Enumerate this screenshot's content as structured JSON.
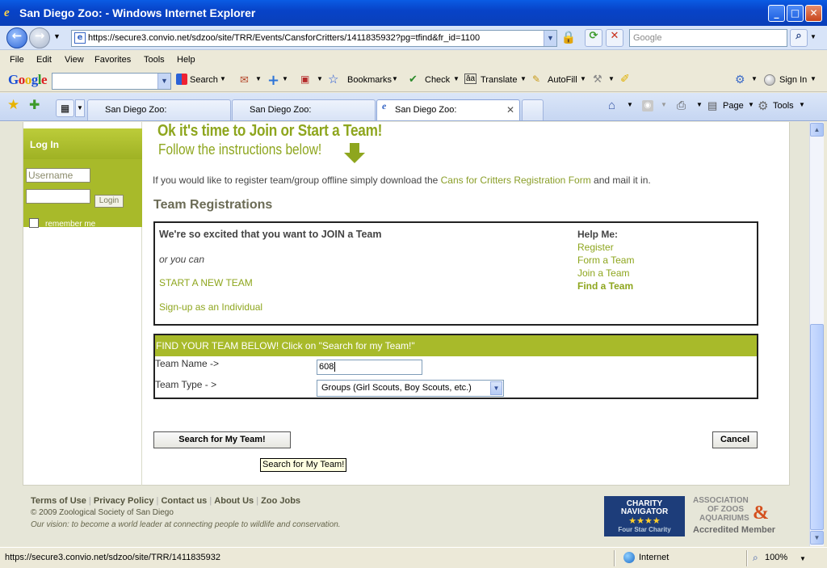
{
  "window": {
    "title": "San Diego Zoo: - Windows Internet Explorer"
  },
  "address_bar": {
    "url": "https://secure3.convio.net/sdzoo/site/TRR/Events/CansforCritters/1411835932?pg=tfind&fr_id=1100",
    "search_placeholder": "Google"
  },
  "menu": [
    "File",
    "Edit",
    "View",
    "Favorites",
    "Tools",
    "Help"
  ],
  "google_toolbar": {
    "logo": "Google",
    "search": "Search",
    "bookmarks": "Bookmarks",
    "check": "Check",
    "translate": "Translate",
    "autofill": "AutoFill",
    "signin": "Sign In"
  },
  "tabs": [
    {
      "label": "San Diego Zoo:",
      "active": false
    },
    {
      "label": "San Diego Zoo:",
      "active": false
    },
    {
      "label": "San Diego Zoo:",
      "active": true
    }
  ],
  "command_bar": {
    "page": "Page",
    "tools": "Tools"
  },
  "sidebar": {
    "login_title": "Log In",
    "username_placeholder": "Username",
    "login_button": "Login",
    "remember_label": "remember me"
  },
  "main": {
    "heading1": "Ok it's time to Join or Start a Team!",
    "heading2": "Follow the instructions below!",
    "intro_before": "If you would like to register team/group offline simply download the ",
    "intro_link": "Cans for Critters Registration Form",
    "intro_after": " and mail it in.",
    "section_title": "Team Registrations",
    "join_heading": "We're so excited that you want to JOIN a Team",
    "or_you_can": "or you can",
    "start_team": "START A NEW TEAM",
    "signup_individual": "Sign-up as an Individual",
    "help_title": "Help Me:",
    "help_links": [
      "Register",
      "Form a Team",
      "Join a Team",
      "Find a Team"
    ],
    "find_header": "FIND YOUR TEAM BELOW! Click on \"Search for my Team!\"",
    "team_name_label": "Team Name ->",
    "team_name_value": "608",
    "team_type_label": "Team Type - >",
    "team_type_value": "Groups (Girl Scouts, Boy Scouts, etc.)",
    "search_button": "Search for My Team!",
    "cancel_button": "Cancel",
    "tooltip": "Search for My Team!"
  },
  "footer": {
    "links": [
      "Terms of Use",
      "Privacy Policy",
      "Contact us",
      "About Us",
      "Zoo Jobs"
    ],
    "copyright": "© 2009 Zoological Society of San Diego",
    "vision": "Our vision: to become a world leader at connecting people to wildlife and conservation.",
    "charity_title_1": "CHARITY",
    "charity_title_2": "NAVIGATOR",
    "charity_stars": "★★★★",
    "charity_sub": "Four Star Charity",
    "aza_line1": "ASSOCIATION",
    "aza_line2": "OF ZOOS",
    "aza_line3": "AQUARIUMS",
    "aza_amp": "&",
    "aza_member": "Accredited Member"
  },
  "status_bar": {
    "url": "https://secure3.convio.net/sdzoo/site/TRR/1411835932",
    "zone": "Internet",
    "zoom": "100%"
  }
}
